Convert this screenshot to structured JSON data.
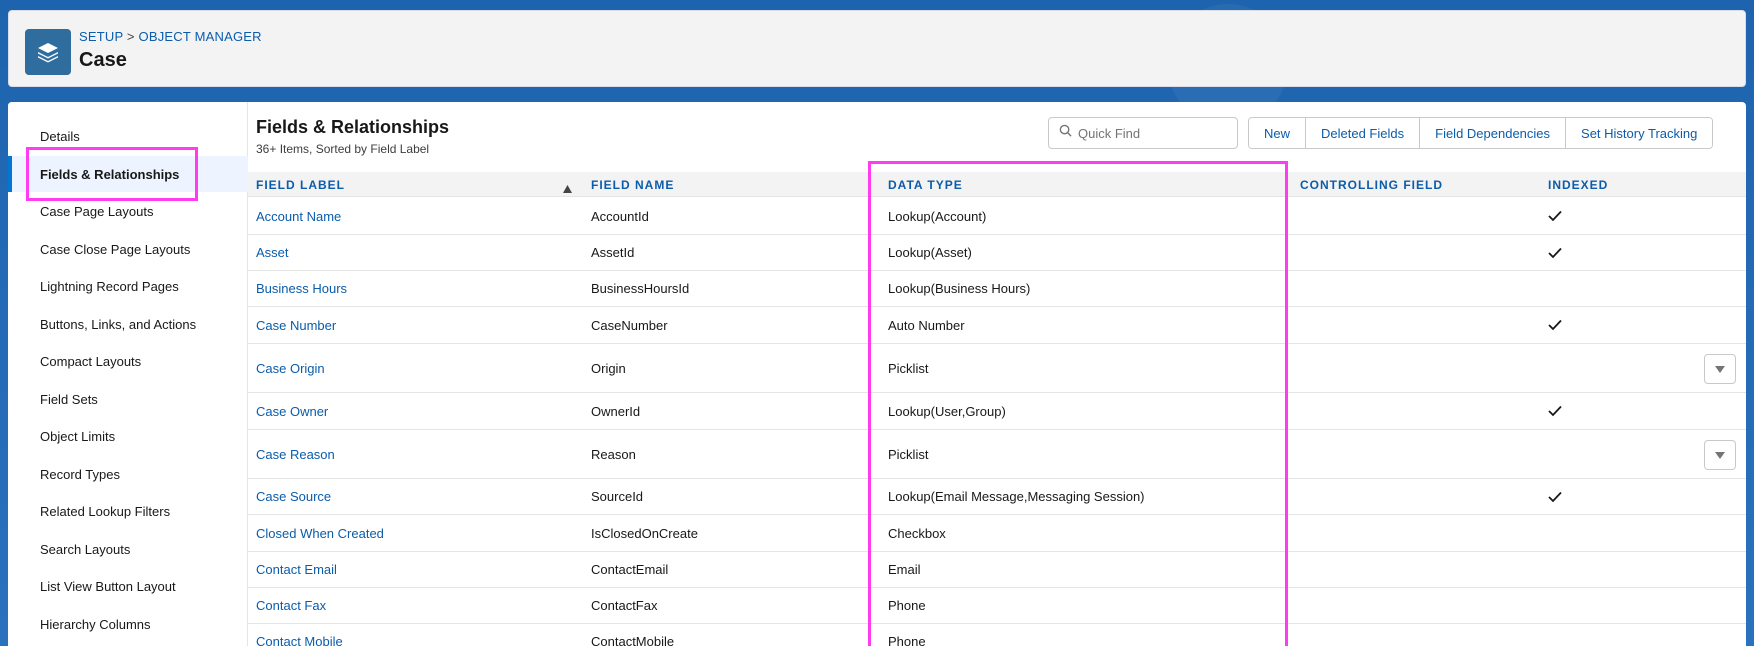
{
  "header": {
    "breadcrumb_setup": "SETUP",
    "breadcrumb_sep": " > ",
    "breadcrumb_object_manager": "OBJECT MANAGER",
    "title": "Case",
    "icon": "layers-icon"
  },
  "sidebar": {
    "items": [
      {
        "label": "Details"
      },
      {
        "label": "Fields & Relationships",
        "active": true
      },
      {
        "label": "Case Page Layouts"
      },
      {
        "label": "Case Close Page Layouts"
      },
      {
        "label": "Lightning Record Pages"
      },
      {
        "label": "Buttons, Links, and Actions"
      },
      {
        "label": "Compact Layouts"
      },
      {
        "label": "Field Sets"
      },
      {
        "label": "Object Limits"
      },
      {
        "label": "Record Types"
      },
      {
        "label": "Related Lookup Filters"
      },
      {
        "label": "Search Layouts"
      },
      {
        "label": "List View Button Layout"
      },
      {
        "label": "Hierarchy Columns"
      }
    ]
  },
  "list": {
    "title": "Fields & Relationships",
    "subtitle": "36+ Items, Sorted by Field Label",
    "quick_find_placeholder": "Quick Find",
    "buttons": {
      "new": "New",
      "deleted_fields": "Deleted Fields",
      "field_dependencies": "Field Dependencies",
      "set_history_tracking": "Set History Tracking"
    }
  },
  "table": {
    "columns": {
      "field_label": "FIELD LABEL",
      "field_name": "FIELD NAME",
      "data_type": "DATA TYPE",
      "controlling_field": "CONTROLLING FIELD",
      "indexed": "INDEXED"
    },
    "rows": [
      {
        "label": "Account Name",
        "name": "AccountId",
        "type": "Lookup(Account)",
        "indexed": true,
        "dropdown": false
      },
      {
        "label": "Asset",
        "name": "AssetId",
        "type": "Lookup(Asset)",
        "indexed": true,
        "dropdown": false
      },
      {
        "label": "Business Hours",
        "name": "BusinessHoursId",
        "type": "Lookup(Business Hours)",
        "indexed": false,
        "dropdown": false
      },
      {
        "label": "Case Number",
        "name": "CaseNumber",
        "type": "Auto Number",
        "indexed": true,
        "dropdown": false
      },
      {
        "label": "Case Origin",
        "name": "Origin",
        "type": "Picklist",
        "indexed": false,
        "dropdown": true
      },
      {
        "label": "Case Owner",
        "name": "OwnerId",
        "type": "Lookup(User,Group)",
        "indexed": true,
        "dropdown": false
      },
      {
        "label": "Case Reason",
        "name": "Reason",
        "type": "Picklist",
        "indexed": false,
        "dropdown": true
      },
      {
        "label": "Case Source",
        "name": "SourceId",
        "type": "Lookup(Email Message,Messaging Session)",
        "indexed": true,
        "dropdown": false
      },
      {
        "label": "Closed When Created",
        "name": "IsClosedOnCreate",
        "type": "Checkbox",
        "indexed": false,
        "dropdown": false
      },
      {
        "label": "Contact Email",
        "name": "ContactEmail",
        "type": "Email",
        "indexed": false,
        "dropdown": false
      },
      {
        "label": "Contact Fax",
        "name": "ContactFax",
        "type": "Phone",
        "indexed": false,
        "dropdown": false
      },
      {
        "label": "Contact Mobile",
        "name": "ContactMobile",
        "type": "Phone",
        "indexed": false,
        "dropdown": false
      }
    ]
  },
  "colors": {
    "highlight": "#ff3cf0",
    "link": "#0b5cab",
    "icon_bg": "#2e6d9e"
  }
}
